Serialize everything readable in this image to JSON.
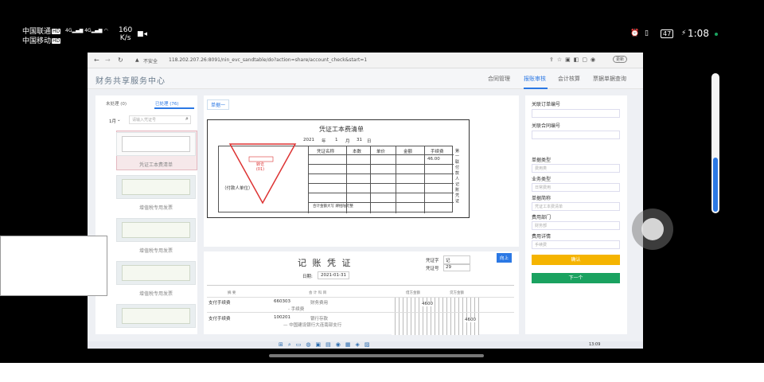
{
  "status_bar": {
    "carrier1": "中国联通",
    "carrier2": "中国移动",
    "hd": "HD",
    "net1": "4G",
    "net2": "4G",
    "speed": "160",
    "speed_unit": "K/s",
    "battery": "47",
    "time": "1:08"
  },
  "browser": {
    "security": "不安全",
    "url": "118.202.207.26:8091/nin_evc_sandtable/do?action=share/account_check&start=1",
    "update": "更新"
  },
  "app": {
    "title": "财务共享服务中心",
    "nav": [
      "合同管理",
      "报账审核",
      "会计核算",
      "票据单据查询"
    ]
  },
  "left": {
    "tab_pending": "未处理 (0)",
    "tab_done": "已处理 (76)",
    "month": "1月",
    "search_placeholder": "请输入凭证号",
    "items": [
      {
        "label": "凭证工本费清单"
      },
      {
        "label": "增值税专用发票"
      },
      {
        "label": "增值税专用发票"
      },
      {
        "label": "增值税专用发票"
      },
      {
        "label": ""
      }
    ]
  },
  "center": {
    "tab": "单据一",
    "doc": {
      "title": "凭证工本费清单",
      "year": "2021",
      "m_unit": "年",
      "month": "1",
      "mo_unit": "月",
      "day": "31",
      "d_unit": "日",
      "cols": [
        "凭证名称",
        "本数",
        "单价",
        "金额",
        "手续费"
      ],
      "fee": "46.00",
      "payer_name": "（付款人单位）",
      "stub": "第一联 付款人记账凭证",
      "total": "合计金额大写 肆拾陆元整",
      "stamp": "转讫 (01)"
    },
    "voucher": {
      "title": "记 账 凭 证",
      "date_label": "日期:",
      "date": "2021-01-31",
      "type_label": "凭证字",
      "type_val": "记",
      "no_label": "凭证号",
      "no_val": "29",
      "go_btn": "向上",
      "headers": [
        "摘 要",
        "会 计 科 目",
        "借方金额",
        "贷方金额"
      ],
      "rows": [
        {
          "summary": "支付手续费",
          "code": "660303",
          "name": "财务费用",
          "sub": "- 手续费",
          "debit": "4600",
          "credit": ""
        },
        {
          "summary": "支付手续费",
          "code": "100201",
          "name": "银行存款",
          "sub": "— 中国建设银行大连南部支行",
          "debit": "",
          "credit": "4600"
        }
      ]
    }
  },
  "right": {
    "fields": [
      {
        "label": "关联订单编号",
        "value": ""
      },
      {
        "label": "关联合同编号",
        "value": ""
      },
      {
        "label": "单据类型",
        "value": "费用类"
      },
      {
        "label": "业务类型",
        "value": "日常费用"
      },
      {
        "label": "单据简称",
        "value": "凭证工本费清单"
      },
      {
        "label": "费用部门",
        "value": "财务部"
      },
      {
        "label": "费用详情",
        "value": "手续费"
      }
    ],
    "confirm_btn": "确认",
    "next_btn": "下一个"
  },
  "taskbar": {
    "time": "13:09"
  },
  "colors": {
    "accent": "#2b78e4",
    "orange": "#f5a623",
    "green": "#1aa260"
  }
}
